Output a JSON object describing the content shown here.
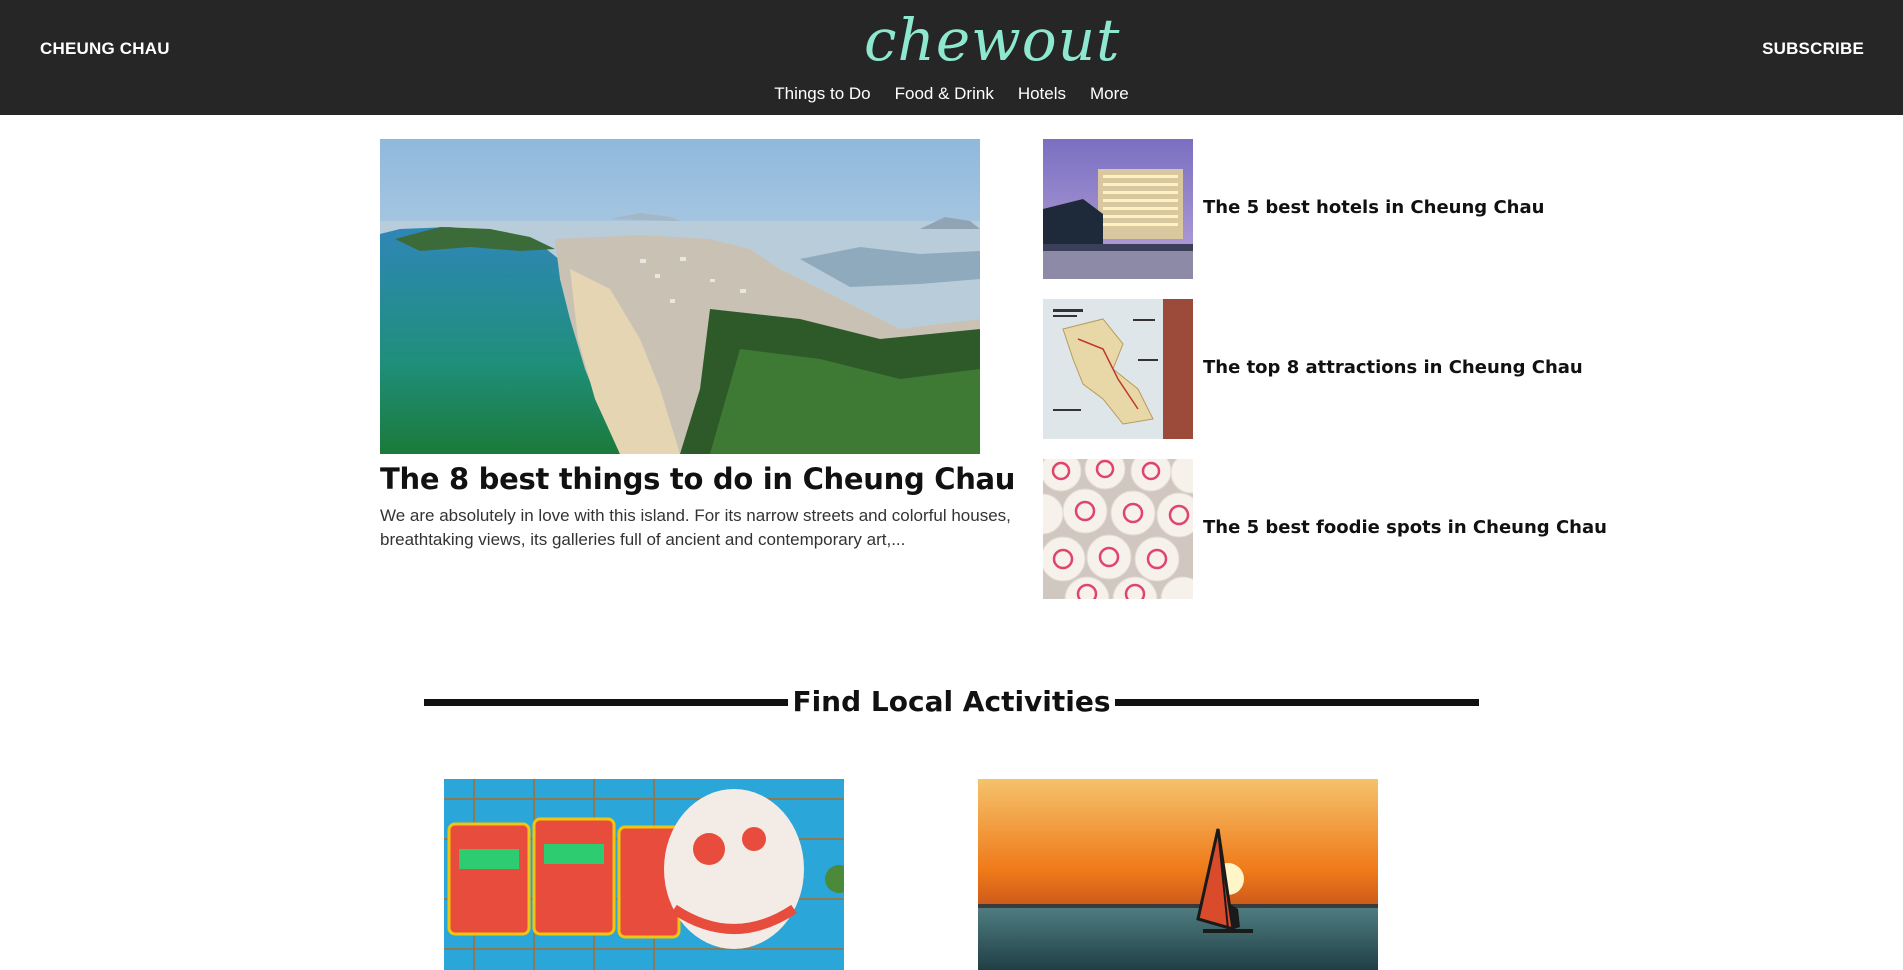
{
  "header": {
    "location": "CHEUNG CHAU",
    "logo": "chewout",
    "subscribe": "SUBSCRIBE",
    "nav": [
      {
        "label": "Things to Do"
      },
      {
        "label": "Food & Drink"
      },
      {
        "label": "Hotels"
      },
      {
        "label": "More"
      }
    ],
    "colors": {
      "background": "#262626",
      "logo": "#8ee8cf"
    }
  },
  "featured": {
    "title": "The 8 best things to do in Cheung Chau",
    "excerpt": "We are absolutely in love with this island. For its narrow streets and colorful houses, breathtaking views, its galleries full of ancient and contemporary art,..."
  },
  "side_articles": [
    {
      "title": "The 5 best hotels in Cheung Chau"
    },
    {
      "title": "The top 8 attractions in Cheung Chau"
    },
    {
      "title": "The 5 best foodie spots in Cheung Chau"
    }
  ],
  "activities_section": {
    "heading": "Find Local Activities"
  }
}
